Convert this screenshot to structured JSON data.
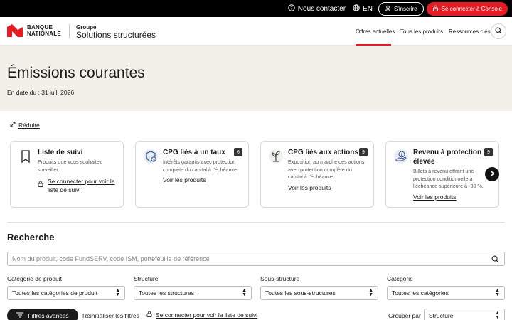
{
  "topbar": {
    "contact": "Nous contacter",
    "lang": "EN",
    "signup": "S'inscrire",
    "login": "Se connecter à Console"
  },
  "header": {
    "logo_line1": "BANQUE",
    "logo_line2": "NATIONALE",
    "groupe": "Groupe",
    "groupe_name": "Solutions structurées",
    "nav": [
      "Offres actuelles",
      "Tous les produits",
      "Ressources clés"
    ]
  },
  "hero": {
    "title": "Émissions courantes",
    "date": "En date du : 31 juil. 2026"
  },
  "reduire": "Réduire",
  "cards": [
    {
      "title": "Liste de suivi",
      "desc": "Produits que vous souhaitez surveiller.",
      "link": "Se connecter pour voir la liste de suivi",
      "icon": "bookmark-icon"
    },
    {
      "title": "CPG liés à un taux",
      "badge": "6",
      "desc": "Intérêts garantis avec protection complète du capital à l'échéance.",
      "link": "Voir les produits",
      "icon": "shield-icon"
    },
    {
      "title": "CPG liés aux actions",
      "badge": "9",
      "desc": "Exposition au marché des actions avec protection complète du capital à l'échéance.",
      "link": "Voir les produits",
      "icon": "plant-icon"
    },
    {
      "title": "Revenu à protection élevée",
      "badge": "9",
      "desc": "Billets à revenu offrant une protection conditionnelle à l'échéance supérieure à -30 %.",
      "link": "Voir les produits",
      "icon": "money-hand-icon"
    }
  ],
  "search": {
    "title": "Recherche",
    "placeholder": "Nom du produit, code FundSERV, code ISM, portefeuille de référence"
  },
  "filters": [
    {
      "label": "Catégorie de produit",
      "value": "Toutes les catégories de produit"
    },
    {
      "label": "Structure",
      "value": "Toutes les structures"
    },
    {
      "label": "Sous-structure",
      "value": "Toutes les sous-structures"
    },
    {
      "label": "Catégorie",
      "value": "Toutes les catégories"
    }
  ],
  "actions": {
    "advanced": "Filtres avancés",
    "reset": "Réinitialiser les filtres",
    "watchlist": "Se connecter pour voir la liste de suivi",
    "group_by": "Grouper par",
    "group_value": "Structure"
  },
  "colors": {
    "brand_red": "#e41c23",
    "hero_bg": "#f3efe9"
  }
}
